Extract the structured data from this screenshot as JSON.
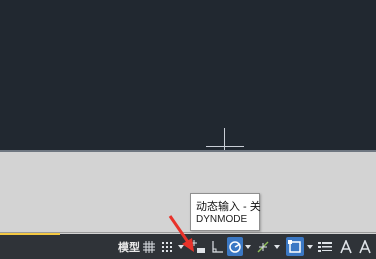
{
  "statusbar": {
    "model_label": "模型",
    "buttons": [
      {
        "icon": "grid-icon"
      },
      {
        "icon": "snap-dots-icon"
      },
      {
        "icon": "dropdown-arrow-icon"
      },
      {
        "icon": "dynamic-input-icon"
      },
      {
        "icon": "ortho-icon"
      },
      {
        "icon": "polar-tracking-icon",
        "active": true
      },
      {
        "icon": "dropdown-arrow-icon"
      },
      {
        "icon": "object-snap-tracking-icon"
      },
      {
        "icon": "dropdown-arrow-icon"
      },
      {
        "icon": "object-snap-icon",
        "active": true
      },
      {
        "icon": "dropdown-arrow-icon"
      },
      {
        "icon": "lineweight-icon"
      },
      {
        "icon": "annotation-scale-icon"
      },
      {
        "icon": "annotation-visibility-icon"
      }
    ]
  },
  "tooltip": {
    "title": "动态输入 - 关",
    "command": "DYNMODE"
  },
  "colors": {
    "canvas_background": "#212830",
    "statusbar_background": "#2f3338",
    "active_button": "#3b78c4",
    "annotation_arrow": "#e8322a"
  }
}
